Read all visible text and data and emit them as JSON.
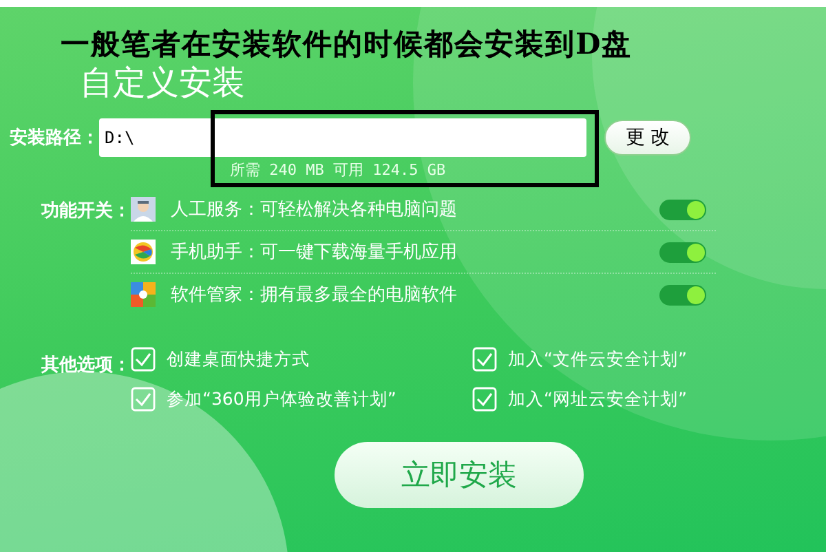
{
  "annotation": "一般笔者在安装软件的时候都会安装到D盘",
  "title": "自定义安装",
  "install_path": {
    "label": "安装路径：",
    "value": "D:\\",
    "button": "更 改",
    "space_info": "所需 240 MB 可用 124.5 GB"
  },
  "features": {
    "label": "功能开关：",
    "items": [
      {
        "kind": "support",
        "text": "人工服务：可轻松解决各种电脑问题",
        "on": true
      },
      {
        "kind": "phone",
        "text": "手机助手：可一键下载海量手机应用",
        "on": true
      },
      {
        "kind": "software",
        "text": "软件管家：拥有最多最全的电脑软件",
        "on": true
      }
    ]
  },
  "other_options": {
    "label": "其他选项：",
    "items": [
      {
        "text": "创建桌面快捷方式",
        "checked": true
      },
      {
        "text": "加入“文件云安全计划”",
        "checked": true
      },
      {
        "text": "参加“360用户体验改善计划”",
        "checked": true
      },
      {
        "text": "加入“网址云安全计划”",
        "checked": true
      }
    ]
  },
  "install_button": "立即安装"
}
